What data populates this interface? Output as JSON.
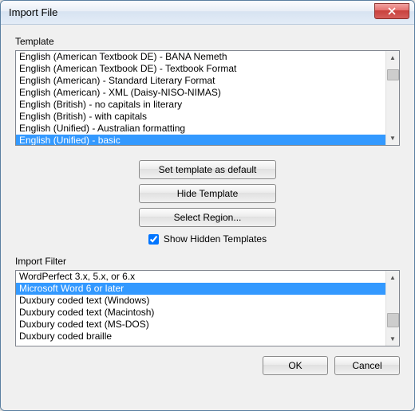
{
  "window": {
    "title": "Import File"
  },
  "template": {
    "label": "Template",
    "items": [
      "English (American Textbook DE) - BANA Nemeth",
      "English (American Textbook DE) - Textbook Format",
      "English (American) - Standard Literary Format",
      "English (American) - XML (Daisy-NISO-NIMAS)",
      "English (British) - no capitals in literary",
      "English (British) - with capitals",
      "English (Unified) - Australian formatting",
      "English (Unified) - basic"
    ],
    "selected_index": 7
  },
  "buttons": {
    "set_default": "Set template as default",
    "hide_template": "Hide Template",
    "select_region": "Select Region...",
    "show_hidden": "Show Hidden Templates",
    "show_hidden_checked": true
  },
  "import_filter": {
    "label": "Import Filter",
    "items": [
      "WordPerfect 3.x, 5.x, or 6.x",
      "Microsoft Word 6 or later",
      "Duxbury coded text (Windows)",
      "Duxbury coded text (Macintosh)",
      "Duxbury coded text (MS-DOS)",
      "Duxbury coded braille"
    ],
    "selected_index": 1
  },
  "footer": {
    "ok": "OK",
    "cancel": "Cancel"
  }
}
